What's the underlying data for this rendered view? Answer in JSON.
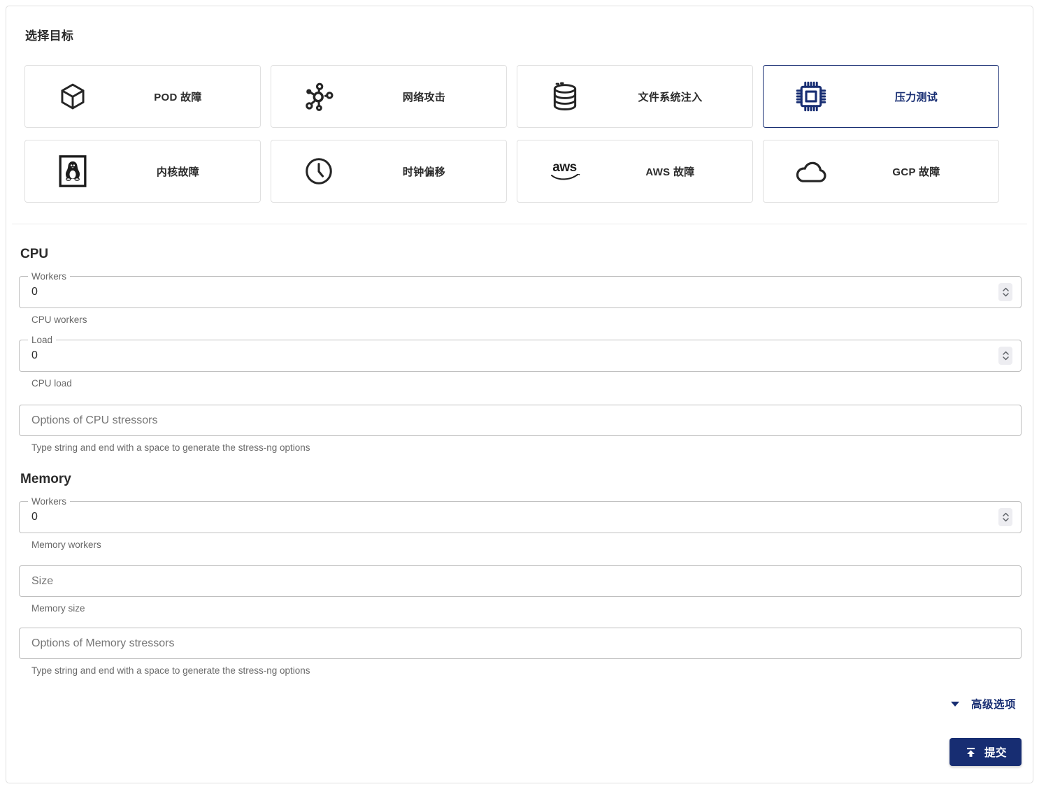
{
  "page": {
    "title": "选择目标"
  },
  "targets": [
    {
      "label": "POD 故障",
      "icon": "pod-cube-icon",
      "selected": false
    },
    {
      "label": "网络攻击",
      "icon": "network-nodes-icon",
      "selected": false
    },
    {
      "label": "文件系统注入",
      "icon": "database-icon",
      "selected": false
    },
    {
      "label": "压力测试",
      "icon": "cpu-chip-icon",
      "selected": true
    },
    {
      "label": "内核故障",
      "icon": "linux-penguin-icon",
      "selected": false
    },
    {
      "label": "时钟偏移",
      "icon": "clock-icon",
      "selected": false
    },
    {
      "label": "AWS 故障",
      "icon": "aws-logo-icon",
      "logo_text": "aws",
      "selected": false
    },
    {
      "label": "GCP 故障",
      "icon": "cloud-icon",
      "selected": false
    }
  ],
  "form": {
    "cpu": {
      "heading": "CPU",
      "workers": {
        "label": "Workers",
        "value": "0",
        "helper": "CPU workers"
      },
      "load": {
        "label": "Load",
        "value": "0",
        "helper": "CPU load"
      },
      "options": {
        "placeholder": "Options of CPU stressors",
        "helper": "Type string and end with a space to generate the stress-ng options"
      }
    },
    "memory": {
      "heading": "Memory",
      "workers": {
        "label": "Workers",
        "value": "0",
        "helper": "Memory workers"
      },
      "size": {
        "placeholder": "Size",
        "helper": "Memory size"
      },
      "options": {
        "placeholder": "Options of Memory stressors",
        "helper": "Type string and end with a space to generate the stress-ng options"
      }
    }
  },
  "footer": {
    "advanced_options_label": "高级选项",
    "submit_label": "提交"
  },
  "colors": {
    "primary": "#172d72",
    "card_border": "#e0e0e0",
    "input_border": "#bfbfbf",
    "helper_text": "#696969"
  }
}
